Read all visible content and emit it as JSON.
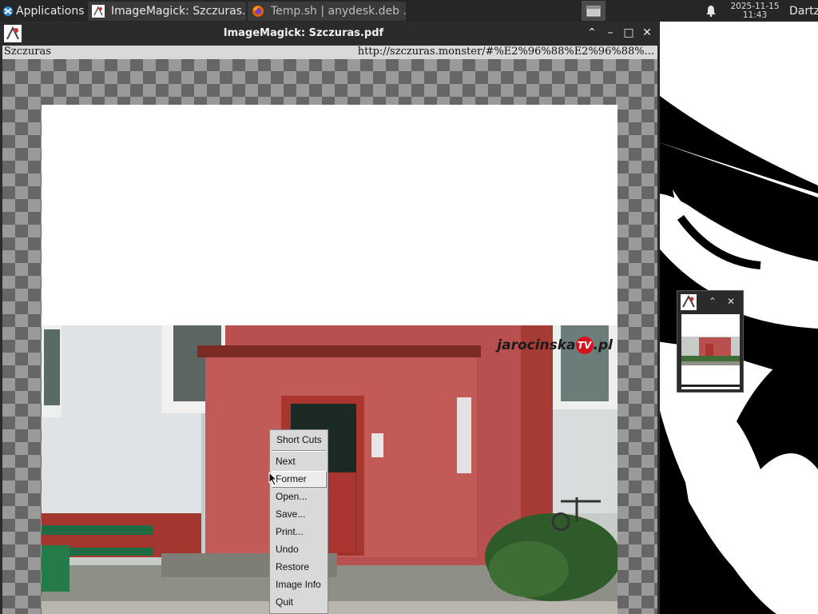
{
  "taskbar": {
    "apps_label": "Applications",
    "apps_suffix": "≡",
    "tasks": [
      {
        "label": "ImageMagick: Szczuras....",
        "active": true
      },
      {
        "label": "Temp.sh | anydesk.deb ...",
        "active": false
      }
    ],
    "clock_date": "2025-11-15",
    "clock_time": "11:43",
    "user": "Dartz"
  },
  "window": {
    "title": "ImageMagick: Szczuras.pdf",
    "buttons": {
      "shade": "⌃",
      "minimize": "–",
      "maximize": "□",
      "close": "✕"
    }
  },
  "infobar": {
    "filename": "Szczuras",
    "url": "http://szczuras.monster/#%E2%96%88%E2%96%88%..."
  },
  "photo": {
    "watermark_main": "jarocinska",
    "watermark_tv": "TV",
    "watermark_suffix": ".pl"
  },
  "menu": {
    "title": "Short Cuts",
    "items": [
      "Next",
      "Former",
      "Open...",
      "Save...",
      "Print...",
      "Undo",
      "Restore",
      "Image Info",
      "Quit"
    ],
    "active_index": 1
  },
  "mini_window": {
    "buttons": {
      "shade": "⌃",
      "close": "✕"
    }
  },
  "colors": {
    "taskbar_bg": "#262626",
    "window_chrome": "#2b2b2b",
    "menu_bg": "#d9d9d9",
    "building_red": "#b8504f",
    "door_red": "#a8362f"
  }
}
